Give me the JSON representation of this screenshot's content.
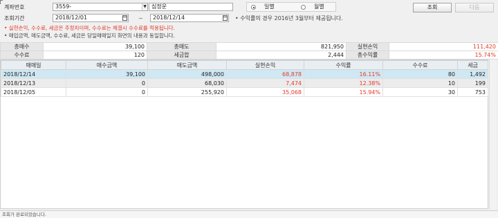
{
  "form": {
    "account_label": "계좌번호",
    "account_value": "3559-",
    "account_name": "심정운",
    "period_label": "조회기간",
    "date_from": "2018/12/01",
    "date_sep": "~",
    "date_to": "2018/12/14",
    "radio_daily": "일별",
    "radio_monthly": "월별",
    "selected_period": "daily",
    "rate_note": "• 수익률의 경우 2016년 3월부터 제공됩니다."
  },
  "buttons": {
    "search": "조회",
    "next": "다음"
  },
  "notices": {
    "red": "• 실현손익, 수수료, 세금은 추정치이며, 수수료는 체결시 수수료를 적용됩니다.",
    "dark": "• 매입금액, 매도금액, 수수료, 세금은 당일매매일지 화면의 내용과 동일합니다."
  },
  "summary": {
    "row1": [
      {
        "label": "총매수",
        "value": "39,100"
      },
      {
        "label": "총매도",
        "value": "821,950"
      },
      {
        "label": "실현손익",
        "value": "111,420"
      }
    ],
    "row2": [
      {
        "label": "수수료",
        "value": "120"
      },
      {
        "label": "세금합",
        "value": "2,444"
      },
      {
        "label": "총수익률",
        "value": "15.74%"
      }
    ]
  },
  "grid": {
    "headers": [
      "매매일",
      "매수금액",
      "매도금액",
      "실현손익",
      "수익률",
      "수수료",
      "세금"
    ],
    "rows": [
      [
        "2018/12/14",
        "39,100",
        "498,000",
        "68,878",
        "16.11%",
        "80",
        "1,492"
      ],
      [
        "2018/12/13",
        "0",
        "68,030",
        "7,474",
        "12.38%",
        "10",
        "199"
      ],
      [
        "2018/12/05",
        "0",
        "255,920",
        "35,068",
        "15.94%",
        "30",
        "753"
      ]
    ]
  },
  "status": {
    "text": "조회가 완료되었습니다."
  },
  "colors": {
    "profit_red": "#e23a2a",
    "selected_row": "#cfe8f3"
  }
}
